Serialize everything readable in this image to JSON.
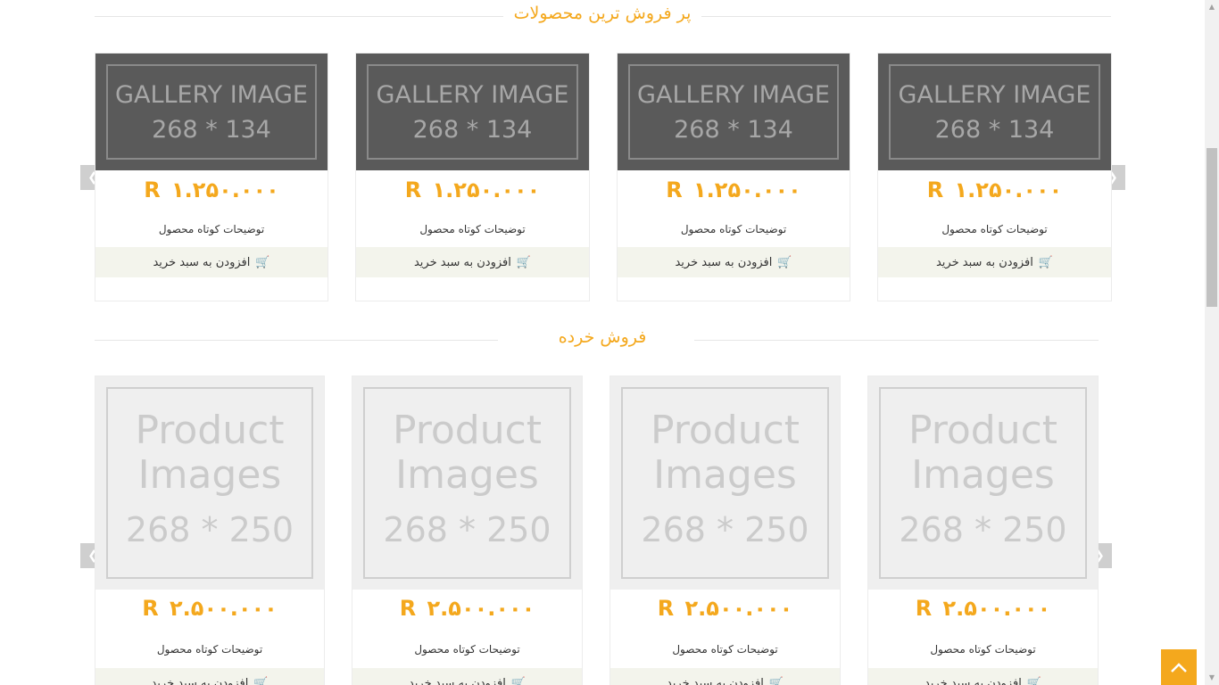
{
  "bestsellers": {
    "title": "پر فروش ترین محصولات",
    "products": [
      {
        "image_line1": "GALLERY IMAGE",
        "image_line2": "268 * 134",
        "price": "R ۱.۲۵۰.۰۰۰",
        "desc": "توضیحات کوتاه محصول",
        "cart": "افزودن به سبد خرید"
      },
      {
        "image_line1": "GALLERY IMAGE",
        "image_line2": "268 * 134",
        "price": "R ۱.۲۵۰.۰۰۰",
        "desc": "توضیحات کوتاه محصول",
        "cart": "افزودن به سبد خرید"
      },
      {
        "image_line1": "GALLERY IMAGE",
        "image_line2": "268 * 134",
        "price": "R ۱.۲۵۰.۰۰۰",
        "desc": "توضیحات کوتاه محصول",
        "cart": "افزودن به سبد خرید"
      },
      {
        "image_line1": "GALLERY IMAGE",
        "image_line2": "268 * 134",
        "price": "R ۱.۲۵۰.۰۰۰",
        "desc": "توضیحات کوتاه محصول",
        "cart": "افزودن به سبد خرید"
      }
    ]
  },
  "retail": {
    "title": "فروش خرده",
    "products": [
      {
        "image_line1": "Product",
        "image_line2": "Images",
        "image_line3": "268 * 250",
        "price": "R ۲.۵۰۰.۰۰۰",
        "desc": "توضیحات کوتاه محصول",
        "cart": "افزودن به سبد خرید"
      },
      {
        "image_line1": "Product",
        "image_line2": "Images",
        "image_line3": "268 * 250",
        "price": "R ۲.۵۰۰.۰۰۰",
        "desc": "توضیحات کوتاه محصول",
        "cart": "افزودن به سبد خرید"
      },
      {
        "image_line1": "Product",
        "image_line2": "Images",
        "image_line3": "268 * 250",
        "price": "R ۲.۵۰۰.۰۰۰",
        "desc": "توضیحات کوتاه محصول",
        "cart": "افزودن به سبد خرید"
      },
      {
        "image_line1": "Product",
        "image_line2": "Images",
        "image_line3": "268 * 250",
        "price": "R ۲.۵۰۰.۰۰۰",
        "desc": "توضیحات کوتاه محصول",
        "cart": "افزودن به سبد خرید"
      }
    ]
  },
  "icons": {
    "cart": "cart-icon",
    "prev": "chevron-left-icon",
    "next": "chevron-right-icon",
    "top": "chevron-up-icon"
  },
  "colors": {
    "accent": "#f4a81d",
    "cart_bg": "#f3f4ec",
    "gallery_bg": "#5a5a5a",
    "product_bg": "#efefef"
  }
}
